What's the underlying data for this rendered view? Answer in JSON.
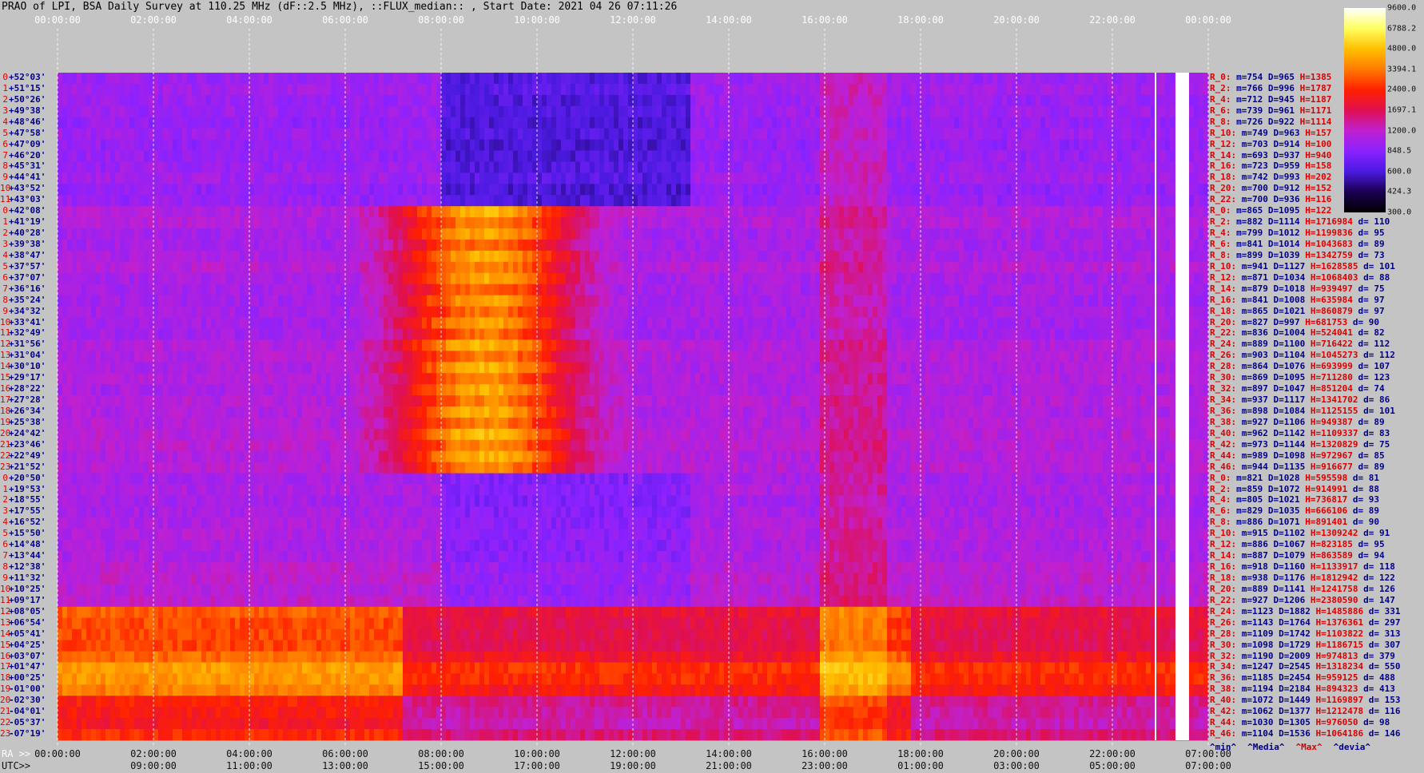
{
  "title": "PRAO of LPI, BSA Daily Survey at 110.25 MHz (dF::2.5 MHz), ::FLUX_median:: , Start Date: 2021 04 26 07:11:26",
  "chart_data": {
    "type": "heatmap",
    "top_axis_ticks": [
      "00:00:00",
      "02:00:00",
      "04:00:00",
      "06:00:00",
      "08:00:00",
      "10:00:00",
      "12:00:00",
      "14:00:00",
      "16:00:00",
      "18:00:00",
      "20:00:00",
      "22:00:00",
      "00:00:00"
    ],
    "ra_axis_prefix": "RA >>",
    "ra_axis_ticks": [
      "00:00:00",
      "02:00:00",
      "04:00:00",
      "06:00:00",
      "08:00:00",
      "10:00:00",
      "12:00:00",
      "14:00:00",
      "16:00:00",
      "18:00:00",
      "20:00:00",
      "22:00:00",
      "07:00:00"
    ],
    "utc_axis_prefix": "UTC>>",
    "utc_axis_ticks": [
      "09:00:00",
      "11:00:00",
      "13:00:00",
      "15:00:00",
      "17:00:00",
      "19:00:00",
      "21:00:00",
      "23:00:00",
      "01:00:00",
      "03:00:00",
      "05:00:00",
      "07:00:00"
    ],
    "colorbar": {
      "ticks": [
        "9600.0",
        "6788.2",
        "4800.0",
        "3394.1",
        "2400.0",
        "1697.1",
        "1200.0",
        "848.5",
        "600.0",
        "424.3",
        "300.0"
      ],
      "range": [
        300,
        9600
      ],
      "scale": "log",
      "palette": [
        "#000000",
        "#1a0050",
        "#4a1ae0",
        "#8a22ff",
        "#c020d0",
        "#e01050",
        "#ff2000",
        "#ff7a00",
        "#ffc000",
        "#ffff60",
        "#ffffff"
      ]
    },
    "rows": [
      {
        "idx": "0",
        "dec": "+52°03'"
      },
      {
        "idx": "1",
        "dec": "+51°15'"
      },
      {
        "idx": "2",
        "dec": "+50°26'"
      },
      {
        "idx": "3",
        "dec": "+49°38'"
      },
      {
        "idx": "4",
        "dec": "+48°46'"
      },
      {
        "idx": "5",
        "dec": "+47°58'"
      },
      {
        "idx": "6",
        "dec": "+47°09'"
      },
      {
        "idx": "7",
        "dec": "+46°20'"
      },
      {
        "idx": "8",
        "dec": "+45°31'"
      },
      {
        "idx": "9",
        "dec": "+44°41'"
      },
      {
        "idx": "10",
        "dec": "+43°52'"
      },
      {
        "idx": "11",
        "dec": "+43°03'"
      },
      {
        "idx": "0",
        "dec": "+42°08'"
      },
      {
        "idx": "1",
        "dec": "+41°19'"
      },
      {
        "idx": "2",
        "dec": "+40°28'"
      },
      {
        "idx": "3",
        "dec": "+39°38'"
      },
      {
        "idx": "4",
        "dec": "+38°47'"
      },
      {
        "idx": "5",
        "dec": "+37°57'"
      },
      {
        "idx": "6",
        "dec": "+37°07'"
      },
      {
        "idx": "7",
        "dec": "+36°16'"
      },
      {
        "idx": "8",
        "dec": "+35°24'"
      },
      {
        "idx": "9",
        "dec": "+34°32'"
      },
      {
        "idx": "10",
        "dec": "+33°41'"
      },
      {
        "idx": "11",
        "dec": "+32°49'"
      },
      {
        "idx": "12",
        "dec": "+31°56'"
      },
      {
        "idx": "13",
        "dec": "+31°04'"
      },
      {
        "idx": "14",
        "dec": "+30°10'"
      },
      {
        "idx": "15",
        "dec": "+29°17'"
      },
      {
        "idx": "16",
        "dec": "+28°22'"
      },
      {
        "idx": "17",
        "dec": "+27°28'"
      },
      {
        "idx": "18",
        "dec": "+26°34'"
      },
      {
        "idx": "19",
        "dec": "+25°38'"
      },
      {
        "idx": "20",
        "dec": "+24°42'"
      },
      {
        "idx": "21",
        "dec": "+23°46'"
      },
      {
        "idx": "22",
        "dec": "+22°49'"
      },
      {
        "idx": "23",
        "dec": "+21°52'"
      },
      {
        "idx": "0",
        "dec": "+20°50'"
      },
      {
        "idx": "1",
        "dec": "+19°53'"
      },
      {
        "idx": "2",
        "dec": "+18°55'"
      },
      {
        "idx": "3",
        "dec": "+17°55'"
      },
      {
        "idx": "4",
        "dec": "+16°52'"
      },
      {
        "idx": "5",
        "dec": "+15°50'"
      },
      {
        "idx": "6",
        "dec": "+14°48'"
      },
      {
        "idx": "7",
        "dec": "+13°44'"
      },
      {
        "idx": "8",
        "dec": "+12°38'"
      },
      {
        "idx": "9",
        "dec": "+11°32'"
      },
      {
        "idx": "10",
        "dec": "+10°25'"
      },
      {
        "idx": "11",
        "dec": "+09°17'"
      },
      {
        "idx": "12",
        "dec": "+08°05'"
      },
      {
        "idx": "13",
        "dec": "+06°54'"
      },
      {
        "idx": "14",
        "dec": "+05°41'"
      },
      {
        "idx": "15",
        "dec": "+04°25'"
      },
      {
        "idx": "16",
        "dec": "+03°07'"
      },
      {
        "idx": "17",
        "dec": "+01°47'"
      },
      {
        "idx": "18",
        "dec": "+00°25'"
      },
      {
        "idx": "19",
        "dec": "-01°00'"
      },
      {
        "idx": "20",
        "dec": "-02°30'"
      },
      {
        "idx": "21",
        "dec": "-04°01'"
      },
      {
        "idx": "22",
        "dec": "-05°37'"
      },
      {
        "idx": "23",
        "dec": "-07°19'"
      }
    ],
    "row_block_levels": [
      {
        "from": 0,
        "to": 12,
        "base": 1100
      },
      {
        "from": 12,
        "to": 36,
        "base": 1300
      },
      {
        "from": 36,
        "to": 48,
        "base": 1250
      },
      {
        "from": 48,
        "to": 60,
        "base": 2200
      }
    ],
    "stats": [
      {
        "r": "R_0:",
        "m": "m=754",
        "D": "D=965",
        "H": "H=1385",
        "d": ""
      },
      {
        "r": "R_2:",
        "m": "m=766",
        "D": "D=996",
        "H": "H=1787",
        "d": ""
      },
      {
        "r": "R_4:",
        "m": "m=712",
        "D": "D=945",
        "H": "H=1187",
        "d": ""
      },
      {
        "r": "R_6:",
        "m": "m=739",
        "D": "D=961",
        "H": "H=1171",
        "d": ""
      },
      {
        "r": "R_8:",
        "m": "m=726",
        "D": "D=922",
        "H": "H=1114",
        "d": ""
      },
      {
        "r": "R_10:",
        "m": "m=749",
        "D": "D=963",
        "H": "H=157",
        "d": ""
      },
      {
        "r": "R_12:",
        "m": "m=703",
        "D": "D=914",
        "H": "H=100",
        "d": ""
      },
      {
        "r": "R_14:",
        "m": "m=693",
        "D": "D=937",
        "H": "H=940",
        "d": ""
      },
      {
        "r": "R_16:",
        "m": "m=723",
        "D": "D=959",
        "H": "H=158",
        "d": ""
      },
      {
        "r": "R_18:",
        "m": "m=742",
        "D": "D=993",
        "H": "H=202",
        "d": ""
      },
      {
        "r": "R_20:",
        "m": "m=700",
        "D": "D=912",
        "H": "H=152",
        "d": ""
      },
      {
        "r": "R_22:",
        "m": "m=700",
        "D": "D=936",
        "H": "H=116",
        "d": ""
      },
      {
        "r": "R_0:",
        "m": "m=865",
        "D": "D=1095",
        "H": "H=122",
        "d": ""
      },
      {
        "r": "R_2:",
        "m": "m=882",
        "D": "D=1114",
        "H": "H=1716984",
        "d": "d= 110"
      },
      {
        "r": "R_4:",
        "m": "m=799",
        "D": "D=1012",
        "H": "H=1199836",
        "d": "d= 95"
      },
      {
        "r": "R_6:",
        "m": "m=841",
        "D": "D=1014",
        "H": "H=1043683",
        "d": "d= 89"
      },
      {
        "r": "R_8:",
        "m": "m=899",
        "D": "D=1039",
        "H": "H=1342759",
        "d": "d= 73"
      },
      {
        "r": "R_10:",
        "m": "m=941",
        "D": "D=1127",
        "H": "H=1628585",
        "d": "d= 101"
      },
      {
        "r": "R_12:",
        "m": "m=871",
        "D": "D=1034",
        "H": "H=1068403",
        "d": "d= 88"
      },
      {
        "r": "R_14:",
        "m": "m=879",
        "D": "D=1018",
        "H": "H=939497",
        "d": "d= 75"
      },
      {
        "r": "R_16:",
        "m": "m=841",
        "D": "D=1008",
        "H": "H=635984",
        "d": "d= 97"
      },
      {
        "r": "R_18:",
        "m": "m=865",
        "D": "D=1021",
        "H": "H=860879",
        "d": "d= 97"
      },
      {
        "r": "R_20:",
        "m": "m=827",
        "D": "D=997",
        "H": "H=681753",
        "d": "d= 90"
      },
      {
        "r": "R_22:",
        "m": "m=836",
        "D": "D=1004",
        "H": "H=524041",
        "d": "d= 82"
      },
      {
        "r": "R_24:",
        "m": "m=889",
        "D": "D=1100",
        "H": "H=716422",
        "d": "d= 112"
      },
      {
        "r": "R_26:",
        "m": "m=903",
        "D": "D=1104",
        "H": "H=1045273",
        "d": "d= 112"
      },
      {
        "r": "R_28:",
        "m": "m=864",
        "D": "D=1076",
        "H": "H=693999",
        "d": "d= 107"
      },
      {
        "r": "R_30:",
        "m": "m=869",
        "D": "D=1095",
        "H": "H=711280",
        "d": "d= 123"
      },
      {
        "r": "R_32:",
        "m": "m=897",
        "D": "D=1047",
        "H": "H=851204",
        "d": "d= 74"
      },
      {
        "r": "R_34:",
        "m": "m=937",
        "D": "D=1117",
        "H": "H=1341702",
        "d": "d= 86"
      },
      {
        "r": "R_36:",
        "m": "m=898",
        "D": "D=1084",
        "H": "H=1125155",
        "d": "d= 101"
      },
      {
        "r": "R_38:",
        "m": "m=927",
        "D": "D=1106",
        "H": "H=949387",
        "d": "d= 89"
      },
      {
        "r": "R_40:",
        "m": "m=962",
        "D": "D=1142",
        "H": "H=1109337",
        "d": "d= 83"
      },
      {
        "r": "R_42:",
        "m": "m=973",
        "D": "D=1144",
        "H": "H=1320829",
        "d": "d= 75"
      },
      {
        "r": "R_44:",
        "m": "m=989",
        "D": "D=1098",
        "H": "H=972967",
        "d": "d= 85"
      },
      {
        "r": "R_46:",
        "m": "m=944",
        "D": "D=1135",
        "H": "H=916677",
        "d": "d= 89"
      },
      {
        "r": "R_0:",
        "m": "m=821",
        "D": "D=1028",
        "H": "H=595598",
        "d": "d= 81"
      },
      {
        "r": "R_2:",
        "m": "m=859",
        "D": "D=1072",
        "H": "H=914991",
        "d": "d= 88"
      },
      {
        "r": "R_4:",
        "m": "m=805",
        "D": "D=1021",
        "H": "H=736817",
        "d": "d= 93"
      },
      {
        "r": "R_6:",
        "m": "m=829",
        "D": "D=1035",
        "H": "H=666106",
        "d": "d= 89"
      },
      {
        "r": "R_8:",
        "m": "m=886",
        "D": "D=1071",
        "H": "H=891401",
        "d": "d= 90"
      },
      {
        "r": "R_10:",
        "m": "m=915",
        "D": "D=1102",
        "H": "H=1309242",
        "d": "d= 91"
      },
      {
        "r": "R_12:",
        "m": "m=886",
        "D": "D=1067",
        "H": "H=823185",
        "d": "d= 95"
      },
      {
        "r": "R_14:",
        "m": "m=887",
        "D": "D=1079",
        "H": "H=863589",
        "d": "d= 94"
      },
      {
        "r": "R_16:",
        "m": "m=918",
        "D": "D=1160",
        "H": "H=1133917",
        "d": "d= 118"
      },
      {
        "r": "R_18:",
        "m": "m=938",
        "D": "D=1176",
        "H": "H=1812942",
        "d": "d= 122"
      },
      {
        "r": "R_20:",
        "m": "m=889",
        "D": "D=1141",
        "H": "H=1241758",
        "d": "d= 126"
      },
      {
        "r": "R_22:",
        "m": "m=927",
        "D": "D=1206",
        "H": "H=2380590",
        "d": "d= 147"
      },
      {
        "r": "R_24:",
        "m": "m=1123",
        "D": "D=1882",
        "H": "H=1485886",
        "d": "d= 331"
      },
      {
        "r": "R_26:",
        "m": "m=1143",
        "D": "D=1764",
        "H": "H=1376361",
        "d": "d= 297"
      },
      {
        "r": "R_28:",
        "m": "m=1109",
        "D": "D=1742",
        "H": "H=1103822",
        "d": "d= 313"
      },
      {
        "r": "R_30:",
        "m": "m=1098",
        "D": "D=1729",
        "H": "H=1186715",
        "d": "d= 307"
      },
      {
        "r": "R_32:",
        "m": "m=1190",
        "D": "D=2009",
        "H": "H=974813",
        "d": "d= 379"
      },
      {
        "r": "R_34:",
        "m": "m=1247",
        "D": "D=2545",
        "H": "H=1318234",
        "d": "d= 550"
      },
      {
        "r": "R_36:",
        "m": "m=1185",
        "D": "D=2454",
        "H": "H=959125",
        "d": "d= 488"
      },
      {
        "r": "R_38:",
        "m": "m=1194",
        "D": "D=2184",
        "H": "H=894323",
        "d": "d= 413"
      },
      {
        "r": "R_40:",
        "m": "m=1072",
        "D": "D=1449",
        "H": "H=1169897",
        "d": "d= 153"
      },
      {
        "r": "R_42:",
        "m": "m=1062",
        "D": "D=1377",
        "H": "H=1212478",
        "d": "d= 116"
      },
      {
        "r": "R_44:",
        "m": "m=1030",
        "D": "D=1305",
        "H": "H=976050",
        "d": "d= 98"
      },
      {
        "r": "R_46:",
        "m": "m=1104",
        "D": "D=1536",
        "H": "H=1064186",
        "d": "d= 146"
      }
    ],
    "stats_footer": [
      "^min^",
      "^Media^",
      "^Max^",
      "^devia^"
    ]
  }
}
